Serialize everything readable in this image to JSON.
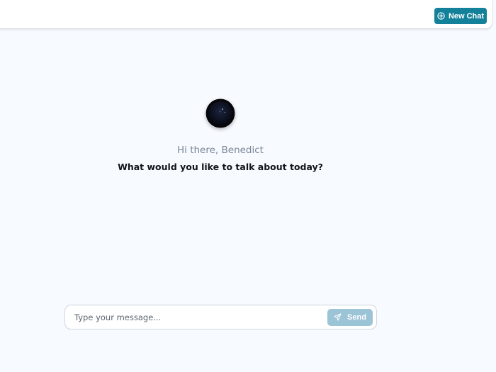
{
  "header": {
    "new_chat_label": "New Chat",
    "new_chat_icon": "plus-circle-icon"
  },
  "hero": {
    "logo_icon": "crescent-moon-logo",
    "greeting": "Hi there, Benedict",
    "prompt": "What would you like to talk about today?"
  },
  "composer": {
    "placeholder": "Type your message...",
    "value": "",
    "send_label": "Send",
    "send_icon": "paper-plane-icon"
  },
  "colors": {
    "background": "#f7faff",
    "accent": "#13819a",
    "send_disabled": "#9cc4d7",
    "greeting_text": "#7b8798"
  }
}
